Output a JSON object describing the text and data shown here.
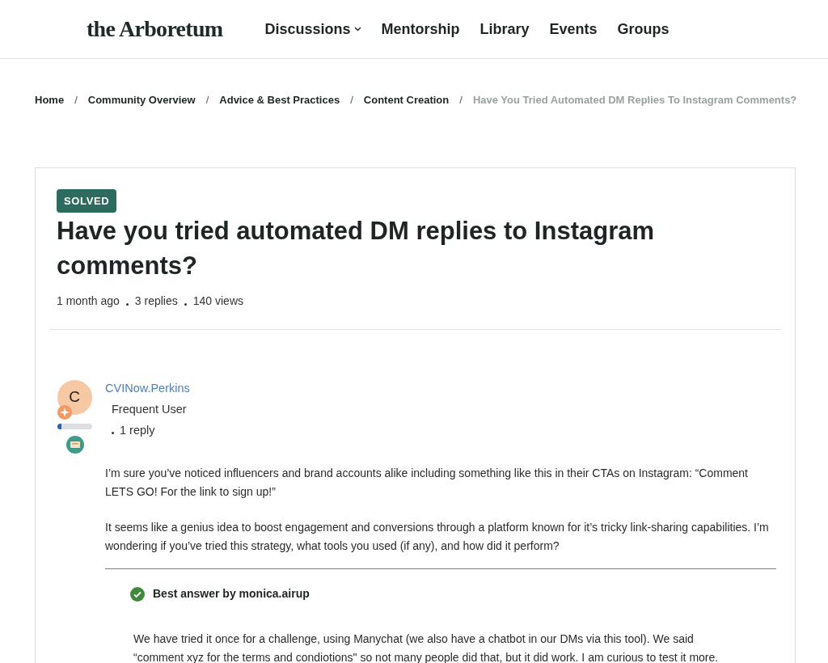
{
  "logo": "the Arboretum",
  "nav": [
    {
      "label": "Discussions",
      "dropdown": true
    },
    {
      "label": "Mentorship",
      "dropdown": false
    },
    {
      "label": "Library",
      "dropdown": false
    },
    {
      "label": "Events",
      "dropdown": false
    },
    {
      "label": "Groups",
      "dropdown": false
    }
  ],
  "breadcrumb": [
    {
      "label": "Home",
      "current": false
    },
    {
      "label": "Community Overview",
      "current": false
    },
    {
      "label": "Advice & Best Practices",
      "current": false
    },
    {
      "label": "Content Creation",
      "current": false
    },
    {
      "label": "Have You Tried Automated DM Replies To Instagram Comments?",
      "current": true
    }
  ],
  "breadcrumb_separator": "/",
  "post": {
    "badge": "SOLVED",
    "title": "Have you tried automated DM replies to Instagram comments?",
    "meta": [
      "1 month ago",
      "3 replies",
      "140 views"
    ],
    "author": {
      "initial": "C",
      "name": "CVINow.Perkins",
      "rank": "Frequent User",
      "replies": "1 reply",
      "level": 0.12
    },
    "paragraphs": [
      "I’m sure you’ve noticed influencers and brand accounts alike including something like this in their CTAs on Instagram: “Comment LETS GO! For the link to sign up!”",
      "It seems like a genius idea to boost engagement and conversions through a platform known for it’s tricky link-sharing capabilities. I’m wondering if you’ve tried this strategy, what tools you used (if any), and how did it perform?"
    ],
    "best_answer": {
      "heading": "Best answer by monica.airup",
      "text": "We have tried it once for a challenge, using Manychat (we also have a chatbot in our DMs via this tool). We said “comment xyz for the terms and condiotions\" so not many people did that, but it did work. I am curious to test it more."
    }
  }
}
